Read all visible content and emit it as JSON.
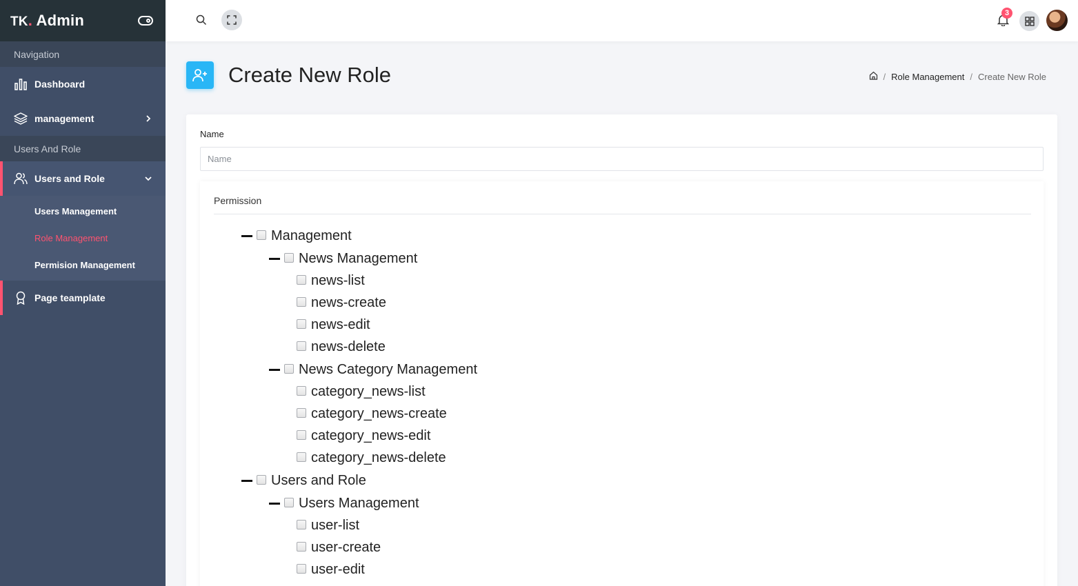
{
  "brand": {
    "prefix": "TK",
    "dot": ".",
    "name": " Admin"
  },
  "sidebar": {
    "caption_navigation": "Navigation",
    "dashboard": "Dashboard",
    "management": "management",
    "caption_users": "Users And Role",
    "users_and_role": "Users and Role",
    "submenu": [
      "Users Management",
      "Role Management",
      "Permision Management"
    ],
    "page_template": "Page teamplate"
  },
  "header": {
    "notification_count": "3"
  },
  "page": {
    "title": "Create New Role",
    "breadcrumb": [
      "Role Management",
      "Create New Role"
    ]
  },
  "form": {
    "name_label": "Name",
    "name_placeholder": "Name",
    "permission_label": "Permission"
  },
  "tree": {
    "management": "Management",
    "news_management": "News Management",
    "news_list": "news-list",
    "news_create": "news-create",
    "news_edit": "news-edit",
    "news_delete": "news-delete",
    "news_category_management": "News Category Management",
    "category_list": "category_news-list",
    "category_create": "category_news-create",
    "category_edit": "category_news-edit",
    "category_delete": "category_news-delete",
    "users_and_role": "Users and Role",
    "users_management": "Users Management",
    "user_list": "user-list",
    "user_create": "user-create",
    "user_edit": "user-edit"
  }
}
